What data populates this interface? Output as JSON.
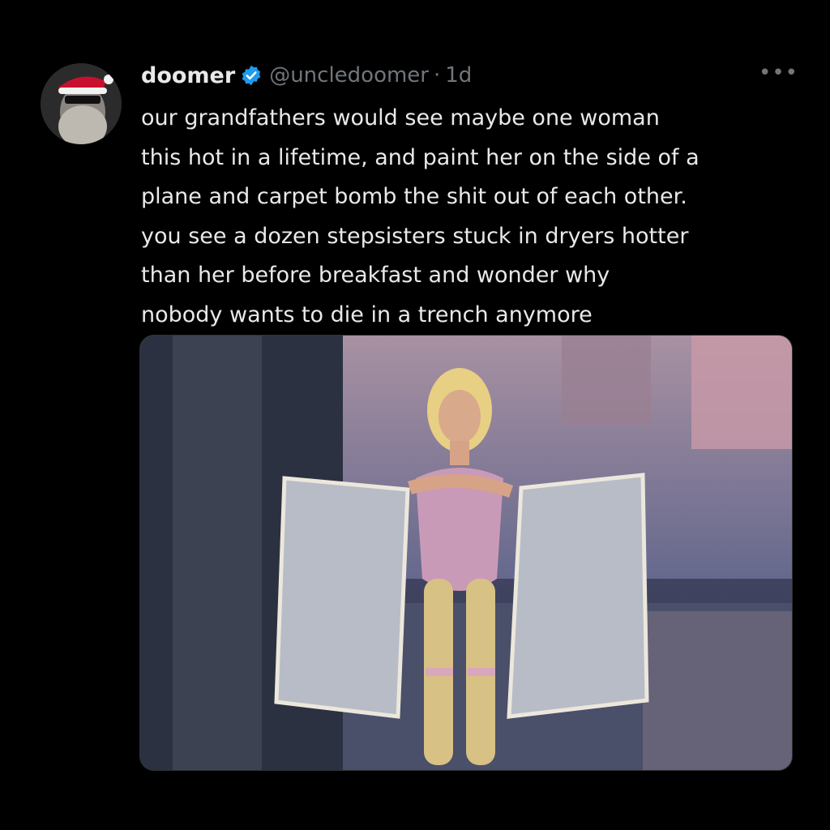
{
  "tweet": {
    "display_name": "doomer",
    "handle": "@uncledoomer",
    "separator": "·",
    "timestamp": "1d",
    "more_label": "•••",
    "text": "our grandfathers would see maybe one woman\nthis hot in a lifetime, and paint her on the side of a\nplane and carpet bomb the shit out of each other.\nyou see a dozen stepsisters stuck in dryers hotter\nthan her before breakfast and wonder why\nnobody wants to die in a trench anymore",
    "avatar_icon": "santa-hat-avatar-icon",
    "verified_icon": "verified-badge-icon",
    "media_icon": "photo-icon"
  },
  "colors": {
    "background": "#000000",
    "text": "#e7e9ea",
    "muted": "#71767b",
    "verified": "#1d9bf0"
  }
}
